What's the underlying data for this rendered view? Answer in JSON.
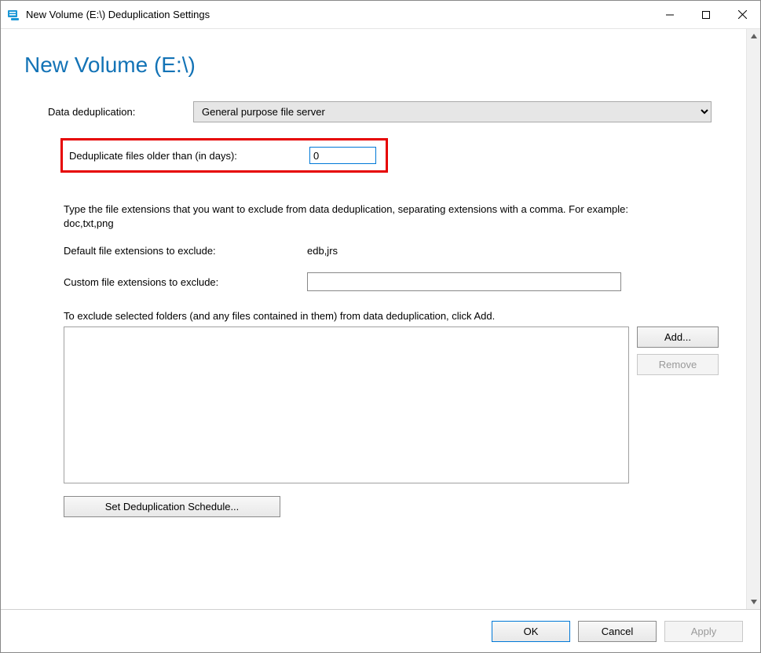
{
  "window": {
    "title": "New Volume (E:\\) Deduplication Settings"
  },
  "heading": "New Volume (E:\\)",
  "labels": {
    "dedup_mode": "Data deduplication:",
    "days": "Deduplicate files older than (in days):",
    "help": "Type the file extensions that you want to exclude from data deduplication, separating extensions with a comma. For example: doc,txt,png",
    "default_ext": "Default file extensions to exclude:",
    "custom_ext": "Custom file extensions to exclude:",
    "folders_help": "To exclude selected folders (and any files contained in them) from data deduplication, click Add."
  },
  "values": {
    "dedup_mode_selected": "General purpose file server",
    "days": "0",
    "default_ext": "edb,jrs",
    "custom_ext": ""
  },
  "buttons": {
    "add": "Add...",
    "remove": "Remove",
    "schedule": "Set Deduplication Schedule...",
    "ok": "OK",
    "cancel": "Cancel",
    "apply": "Apply"
  }
}
